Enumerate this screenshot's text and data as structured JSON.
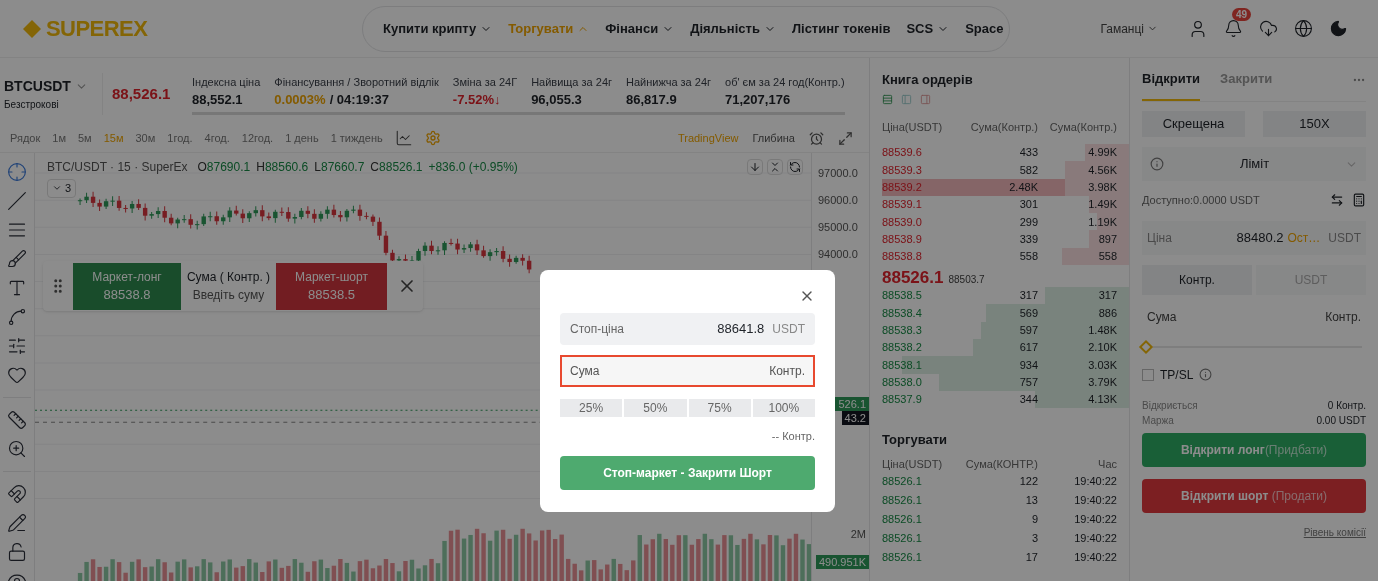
{
  "header": {
    "logo": "SUPEREX",
    "nav": [
      {
        "label": "Купити крипту",
        "dropdown": true,
        "selected": false
      },
      {
        "label": "Торгувати",
        "dropdown": true,
        "selected": true
      },
      {
        "label": "Фінанси",
        "dropdown": true,
        "selected": false
      },
      {
        "label": "Діяльність",
        "dropdown": true,
        "selected": false
      },
      {
        "label": "Лістинг токенів",
        "dropdown": false,
        "selected": false
      },
      {
        "label": "SCS",
        "dropdown": true,
        "selected": false
      },
      {
        "label": "Space",
        "dropdown": false,
        "selected": false
      }
    ],
    "wallet": "Гаманці",
    "notifications": "49"
  },
  "ticker": {
    "symbol": "BTCUSDT",
    "type": "Безстрокові",
    "price": "88,526.1",
    "stats": [
      {
        "label": "Індексна ціна",
        "value": "88,552.1",
        "kind": "plain"
      },
      {
        "label": "Фінансування / Зворотний відлік",
        "value": "0.0003%",
        "extra": "/ 04:19:37",
        "kind": "funding"
      },
      {
        "label": "Зміна за 24Г",
        "value": "-7.52%↓",
        "kind": "down"
      },
      {
        "label": "Найвища за 24г",
        "value": "96,055.3",
        "kind": "plain"
      },
      {
        "label": "Найнижча за 24г",
        "value": "86,817.9",
        "kind": "plain"
      },
      {
        "label": "об' єм за 24 год(Контр.)",
        "value": "71,207,176",
        "kind": "plain"
      }
    ]
  },
  "toolbar": {
    "intervals": [
      {
        "label": "Рядок",
        "selected": false
      },
      {
        "label": "1м",
        "selected": false
      },
      {
        "label": "5м",
        "selected": false
      },
      {
        "label": "15м",
        "selected": true
      },
      {
        "label": "30м",
        "selected": false
      },
      {
        "label": "1год.",
        "selected": false
      },
      {
        "label": "4год.",
        "selected": false
      },
      {
        "label": "12год.",
        "selected": false
      },
      {
        "label": "1 день",
        "selected": false
      },
      {
        "label": "1 тиждень",
        "selected": false
      }
    ],
    "views": [
      {
        "label": "TradingView",
        "selected": true
      },
      {
        "label": "Глибина",
        "selected": false
      }
    ]
  },
  "chart": {
    "title": "BTC/USDT · 15 · SuperEx",
    "ohlc": [
      {
        "label": "O",
        "value": "87690.1"
      },
      {
        "label": "H",
        "value": "88560.6"
      },
      {
        "label": "L",
        "value": "87660.7"
      },
      {
        "label": "C",
        "value": "88526.1"
      }
    ],
    "change": "+836.0 (+0.95%)",
    "indicators": "3",
    "price_axis": [
      "97000.0",
      "96000.0",
      "95000.0",
      "94000.0"
    ],
    "tags": [
      {
        "text": "526.1",
        "kind": "last"
      },
      {
        "text": "43.2",
        "kind": "mark"
      },
      {
        "text": "2M",
        "kind": "axis"
      },
      {
        "text": "490.951K",
        "kind": "volume"
      }
    ]
  },
  "quick_trade": {
    "long": {
      "label": "Маркет-лонг",
      "price": "88538.8"
    },
    "amount_label": "Сума ( Контр. )",
    "amount_placeholder": "Введіть суму",
    "short": {
      "label": "Маркет-шорт",
      "price": "88538.5"
    }
  },
  "order_book": {
    "title": "Книга ордерів",
    "columns": [
      "Ціна(USDT)",
      "Сума(Контр.)",
      "Сума(Контр.)"
    ],
    "asks": [
      {
        "price": "88539.6",
        "amount": "433",
        "total": "4.99K",
        "level": 0.18,
        "highlighted": false
      },
      {
        "price": "88539.3",
        "amount": "582",
        "total": "4.56K",
        "level": 0.26,
        "highlighted": false
      },
      {
        "price": "88539.2",
        "amount": "2.48K",
        "total": "3.98K",
        "level": 0.26,
        "highlighted": true
      },
      {
        "price": "88539.1",
        "amount": "301",
        "total": "1.49K",
        "level": 0.16,
        "highlighted": false
      },
      {
        "price": "88539.0",
        "amount": "299",
        "total": "1.19K",
        "level": 0.13,
        "highlighted": false
      },
      {
        "price": "88538.9",
        "amount": "339",
        "total": "897",
        "level": 0.16,
        "highlighted": false
      },
      {
        "price": "88538.8",
        "amount": "558",
        "total": "558",
        "level": 0.27,
        "highlighted": false
      }
    ],
    "mid": {
      "price": "88526.1",
      "mark": "88503.7"
    },
    "bids": [
      {
        "price": "88538.5",
        "amount": "317",
        "total": "317",
        "level": 0.34,
        "highlighted": false
      },
      {
        "price": "88538.4",
        "amount": "569",
        "total": "886",
        "level": 0.58,
        "highlighted": false
      },
      {
        "price": "88538.3",
        "amount": "597",
        "total": "1.48K",
        "level": 0.6,
        "highlighted": false
      },
      {
        "price": "88538.2",
        "amount": "617",
        "total": "2.10K",
        "level": 0.63,
        "highlighted": false
      },
      {
        "price": "88538.1",
        "amount": "934",
        "total": "3.03K",
        "level": 0.92,
        "highlighted": false
      },
      {
        "price": "88538.0",
        "amount": "757",
        "total": "3.79K",
        "level": 0.77,
        "highlighted": false
      },
      {
        "price": "88537.9",
        "amount": "344",
        "total": "4.13K",
        "level": 0.38,
        "highlighted": false
      }
    ]
  },
  "trades": {
    "title": "Торгувати",
    "columns": [
      "Ціна(USDT)",
      "Сума(КОНТР.)",
      "Час"
    ],
    "rows": [
      {
        "price": "88526.1",
        "amount": "122",
        "time": "19:40:22"
      },
      {
        "price": "88526.1",
        "amount": "13",
        "time": "19:40:22"
      },
      {
        "price": "88526.1",
        "amount": "9",
        "time": "19:40:22"
      },
      {
        "price": "88526.1",
        "amount": "3",
        "time": "19:40:22"
      },
      {
        "price": "88526.1",
        "amount": "17",
        "time": "19:40:22"
      }
    ]
  },
  "order_form": {
    "tabs": [
      {
        "label": "Відкрити",
        "selected": true
      },
      {
        "label": "Закрити",
        "selected": false
      }
    ],
    "margin_mode": "Скрещена",
    "leverage": "150X",
    "order_type": "Ліміт",
    "available": "Доступно:0.0000 USDT",
    "price": {
      "label": "Ціна",
      "value": "88480.2",
      "hint": "Ост…",
      "unit": "USDT"
    },
    "units": [
      {
        "label": "Контр.",
        "selected": true
      },
      {
        "label": "USDT",
        "selected": false
      }
    ],
    "amount": {
      "placeholder": "Сума",
      "unit": "Контр."
    },
    "slider": {
      "level": 0
    },
    "tpsl": {
      "label": "TP/SL",
      "checked": false
    },
    "summary": [
      {
        "label": "Відкриється",
        "value": "0 Контр."
      },
      {
        "label": "Маржа",
        "value": "0.00 USDT"
      }
    ],
    "buy": {
      "label": "Відкрити лонг",
      "note": "(Придбати)"
    },
    "sell": {
      "label": "Відкрити шорт",
      "note": "(Продати)"
    },
    "fee_link": "Рівень комісії"
  },
  "modal": {
    "stop_price": {
      "label": "Стоп-ціна",
      "value": "88641.8",
      "unit": "USDT"
    },
    "amount": {
      "placeholder": "Сума",
      "unit": "Контр.",
      "focused": true
    },
    "percents": [
      "25%",
      "50%",
      "75%",
      "100%"
    ],
    "estimate": "-- Контр.",
    "submit": "Стоп-маркет - Закрити Шорт"
  }
}
